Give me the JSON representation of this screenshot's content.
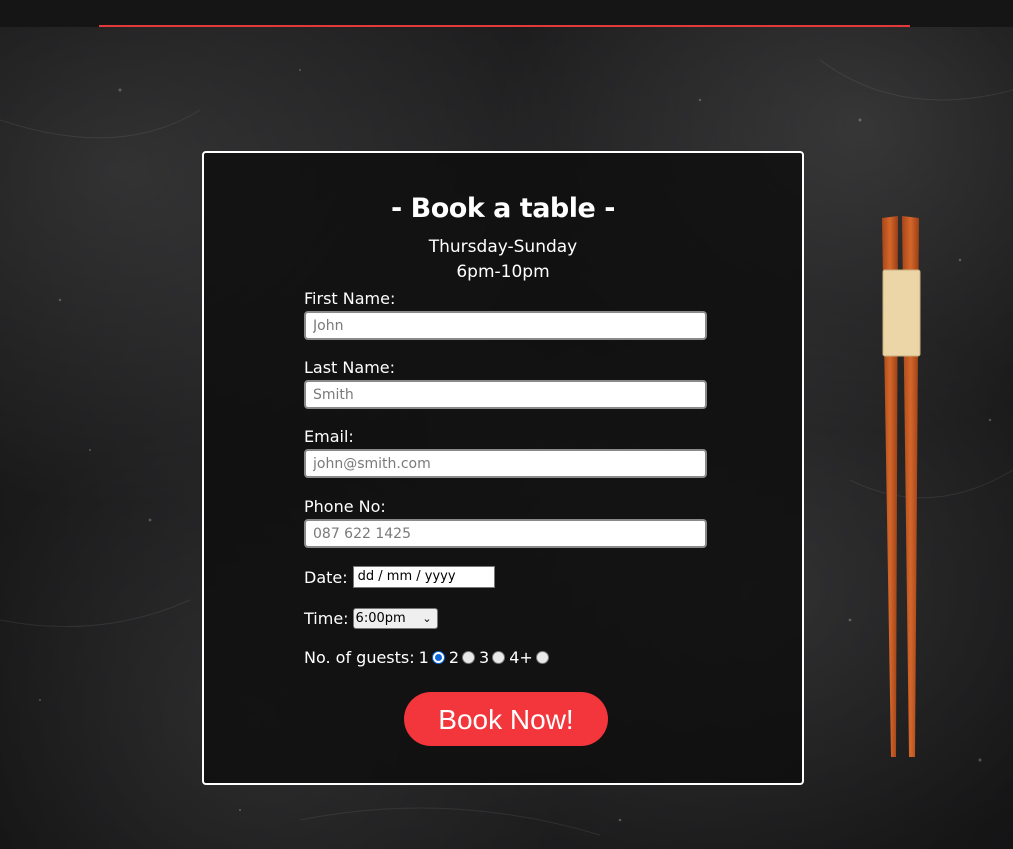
{
  "form": {
    "title": "- Book a table -",
    "days": "Thursday-Sunday",
    "hours": "6pm-10pm",
    "first_name": {
      "label": "First Name:",
      "placeholder": "John"
    },
    "last_name": {
      "label": "Last Name:",
      "placeholder": "Smith"
    },
    "email": {
      "label": "Email:",
      "placeholder": "john@smith.com"
    },
    "phone": {
      "label": "Phone No:",
      "placeholder": "087 622 1425"
    },
    "date": {
      "label": "Date:",
      "placeholder": "dd / mm / yyyy"
    },
    "time": {
      "label": "Time:",
      "selected": "6:00pm"
    },
    "guests": {
      "label": "No. of guests:",
      "options": [
        "1",
        "2",
        "3",
        "4+"
      ],
      "selected": "1"
    },
    "submit_label": "Book Now!"
  },
  "colors": {
    "accent": "#f2363b",
    "topbar_line": "#e23a3a",
    "radio_checked": "#0b64d8"
  }
}
